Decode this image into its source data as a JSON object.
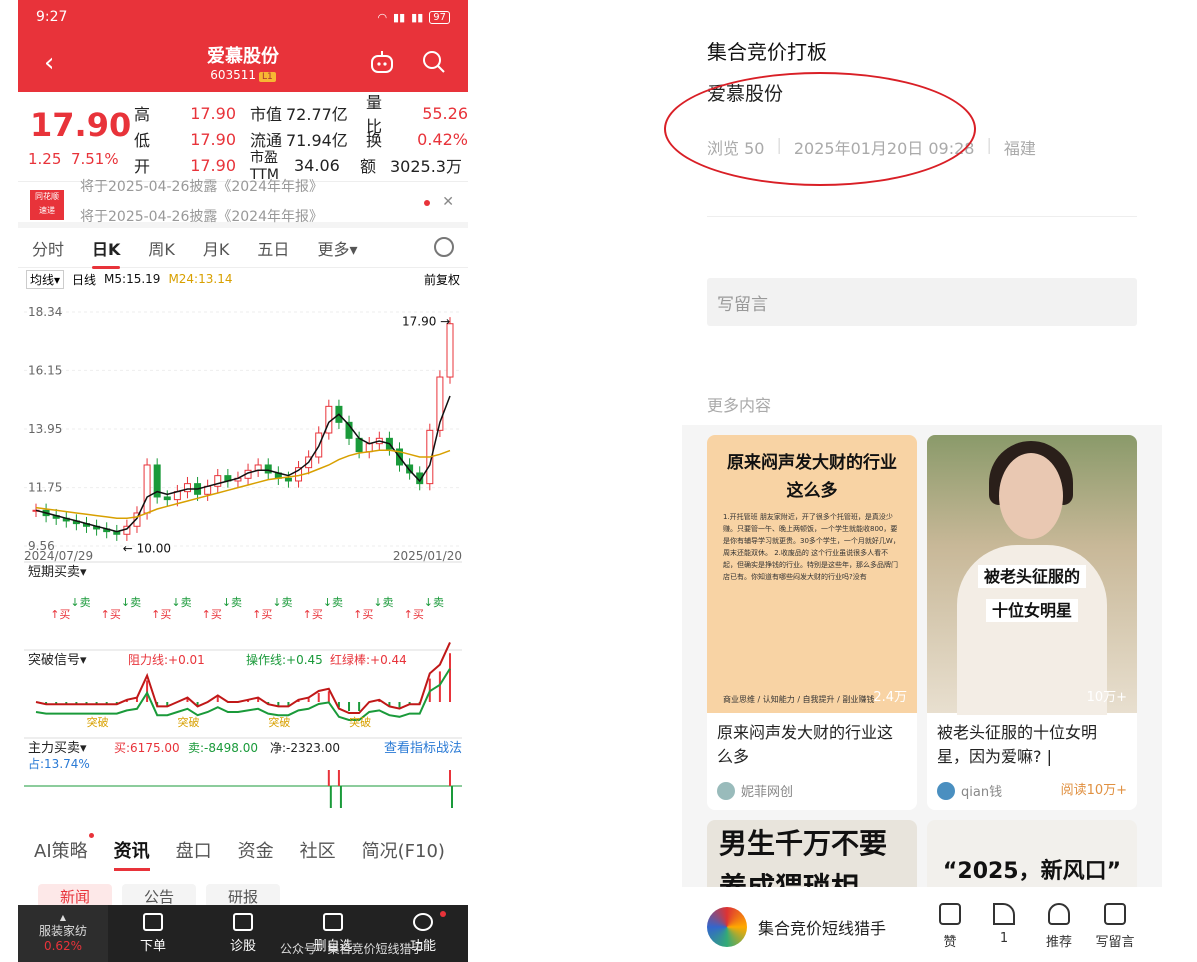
{
  "status": {
    "time": "9:27",
    "battery": "97"
  },
  "stock": {
    "name": "爱慕股份",
    "code": "603511",
    "level": "L1",
    "price": "17.90",
    "change": "1.25",
    "change_pct": "7.51%",
    "rows": [
      {
        "k1": "高",
        "v1": "17.90",
        "k2": "市值",
        "v2": "72.77亿",
        "k3": "量比",
        "v3": "55.26"
      },
      {
        "k1": "低",
        "v1": "17.90",
        "k2": "流通",
        "v2": "71.94亿",
        "k3": "换",
        "v3": "0.42%"
      },
      {
        "k1": "开",
        "v1": "17.90",
        "k2": "市盈TTM",
        "v2": "34.06",
        "k3": "额",
        "v3": "3025.3万"
      }
    ]
  },
  "news": {
    "logo": "同花顺 速递",
    "line1": "将于2025-04-26披露《2024年年报》",
    "line2": "将于2025-04-26披露《2024年年报》"
  },
  "ktabs": [
    "分时",
    "日K",
    "周K",
    "月K",
    "五日",
    "更多▾"
  ],
  "mabar": {
    "select": "均线▾",
    "period": "日线",
    "m5": "M5:15.19",
    "m24": "M24:13.14",
    "adjust": "前复权"
  },
  "chart_data": {
    "type": "line",
    "title": "",
    "x_range": [
      "2024/07/29",
      "2025/01/20"
    ],
    "y_ticks": [
      "18.34",
      "16.15",
      "13.95",
      "11.75",
      "9.56"
    ],
    "ylim": [
      9.56,
      18.34
    ],
    "annotations": {
      "high_label": "17.90",
      "low_label": "10.00"
    },
    "series": [
      {
        "name": "close",
        "values": [
          10.9,
          10.7,
          10.6,
          10.5,
          10.4,
          10.3,
          10.2,
          10.1,
          10.0,
          10.3,
          10.8,
          12.6,
          11.4,
          11.3,
          11.6,
          11.9,
          11.5,
          11.8,
          12.2,
          12.0,
          12.1,
          12.4,
          12.6,
          12.3,
          12.1,
          12.0,
          12.5,
          12.9,
          13.8,
          14.8,
          14.2,
          13.6,
          13.1,
          13.4,
          13.6,
          13.2,
          12.6,
          12.3,
          11.9,
          13.9,
          15.9,
          17.9
        ]
      },
      {
        "name": "M5",
        "values": [
          10.9,
          10.8,
          10.7,
          10.6,
          10.5,
          10.4,
          10.3,
          10.2,
          10.1,
          10.2,
          10.6,
          11.4,
          11.6,
          11.5,
          11.6,
          11.7,
          11.7,
          11.8,
          11.9,
          12.0,
          12.1,
          12.3,
          12.4,
          12.4,
          12.3,
          12.2,
          12.4,
          12.7,
          13.3,
          14.2,
          14.5,
          14.1,
          13.6,
          13.4,
          13.5,
          13.4,
          12.9,
          12.4,
          12.0,
          12.6,
          14.2,
          15.19
        ]
      },
      {
        "name": "M24",
        "values": [
          11.0,
          10.95,
          10.9,
          10.85,
          10.8,
          10.75,
          10.7,
          10.65,
          10.6,
          10.6,
          10.65,
          10.8,
          10.95,
          11.05,
          11.15,
          11.25,
          11.35,
          11.45,
          11.55,
          11.65,
          11.75,
          11.85,
          11.95,
          12.05,
          12.1,
          12.15,
          12.2,
          12.3,
          12.45,
          12.6,
          12.8,
          12.95,
          13.05,
          13.1,
          13.15,
          13.15,
          13.1,
          13.0,
          12.9,
          12.9,
          13.0,
          13.14
        ]
      }
    ]
  },
  "indicators": {
    "short": {
      "name": "短期买卖▾",
      "buy": "买",
      "sell": "卖"
    },
    "breakout": {
      "name": "突破信号▾",
      "resist": "阻力线:+0.01",
      "op": "操作线:+0.45",
      "rg": "红绿棒:+0.44",
      "label": "突破"
    },
    "main": {
      "name": "主力买卖▾",
      "buy": "买:6175.00",
      "sell": "卖:-8498.00",
      "net": "净:-2323.00",
      "link": "查看指标战法",
      "share": "占:13.74%"
    }
  },
  "bottom_tabs": [
    "AI策略",
    "资讯",
    "盘口",
    "资金",
    "社区",
    "简况(F10)"
  ],
  "sub_tabs": [
    "新闻",
    "公告",
    "研报"
  ],
  "navbar": {
    "first": "服装家纺",
    "first_pct": "0.62%",
    "items": [
      "下单",
      "诊股",
      "删自选",
      "功能"
    ]
  },
  "watermark": "公众号 · 集合竞价短线猎手",
  "article": {
    "title": "集合竞价打板",
    "subtitle": "爱慕股份",
    "views": "浏览 50",
    "date": "2025年01月20日 09:28",
    "location": "福建",
    "comment_placeholder": "写留言",
    "more": "更多内容",
    "cards": [
      {
        "img_title": "原来闷声发大财的行业这么多",
        "img_text": "1.开托管班 朋友家附近，开了很多个托管班，是真没少赚。只要管一午、晚上两顿饭，一个学生就能收800，要是你有辅导学习就更贵。30多个学生，一个月就好几W，周末还能双休。 2.收废品的 这个行业虽说很多人看不起，但确实是挣钱的行业。特别是这些年，那么多品牌门店已有。你知道有哪些闷发大财的行业吗?没有",
        "title": "原来闷声发大财的行业这么多",
        "views": "2.4万",
        "author": "妮菲网创",
        "img_footer": "商业思维 / 认知能力 / 自我提升 / 副业赚钱"
      },
      {
        "label1": "被老头征服的",
        "label2": "十位女明星",
        "title": "被老头征服的十位女明星，因为爱嘛? |",
        "views": "10万+",
        "author": "qian钱",
        "reads": "阅读10万+"
      },
      {
        "img_title": "男生千万不要 养成猥琐相"
      },
      {
        "img_title": "“2025，新风口”"
      }
    ],
    "author": "集合竞价短线猎手",
    "actions": [
      "赞",
      "1",
      "推荐",
      "写留言"
    ]
  }
}
